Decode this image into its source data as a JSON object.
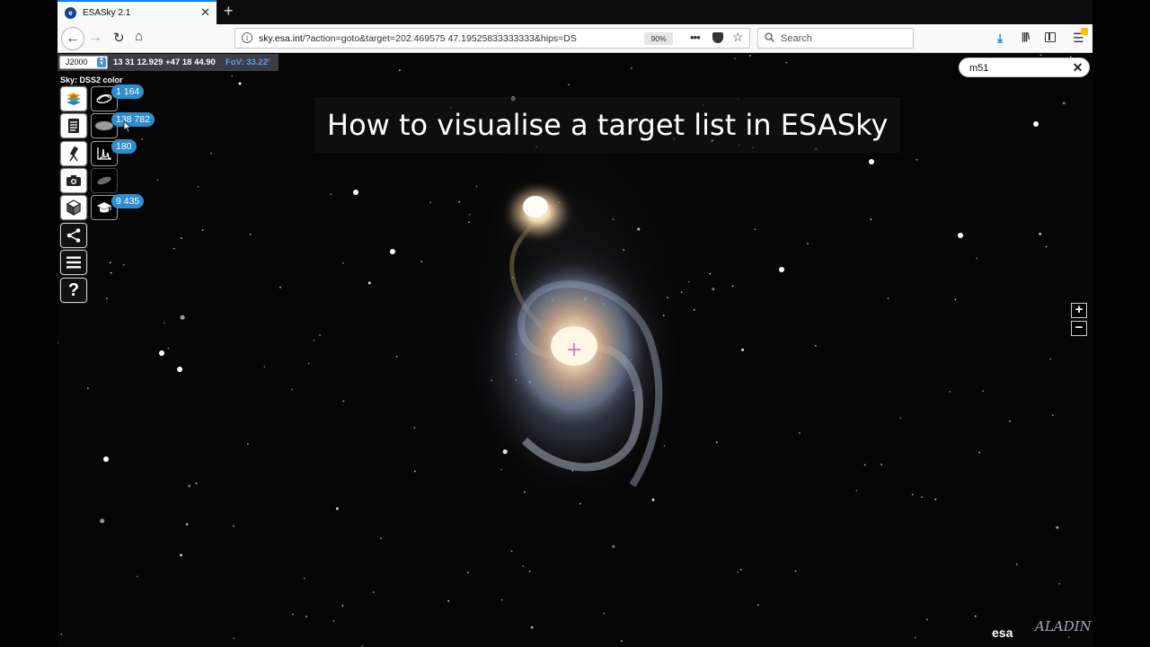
{
  "browser": {
    "tab_title": "ESASky 2.1",
    "favicon_letter": "e",
    "url_host": "sky.esa.int",
    "url_rest": "/?action=goto&target=202.469575 47.19525833333333&hips=DS",
    "zoom_level": "90%",
    "search_placeholder": "Search"
  },
  "esasky": {
    "frame": "J2000",
    "coordinates": "13 31 12.929 +47 18 44.90",
    "fov": "FoV: 33.22'",
    "sky_label": "Sky: DSS2 color",
    "target_query": "m51",
    "overlay_title": "How to visualise a target list in ESASky",
    "badges": {
      "galaxies": "1 164",
      "catalogues": "138 782",
      "spectra": "180",
      "publications": "9 435"
    },
    "icons": [
      "sky-layers-icon",
      "galaxy-icon",
      "catalogue-list-icon",
      "catalogue-disk-icon",
      "telescope-icon",
      "spectra-icon",
      "camera-icon",
      "tilted-ellipse-icon",
      "cube-icon",
      "graduation-cap-icon",
      "share-icon",
      "menu-icon",
      "help-icon"
    ],
    "zoom_in": "+",
    "zoom_out": "−",
    "logo_esa": "esa",
    "logo_aladin": "ALADIN"
  },
  "colors": {
    "badge": "#2d8dcf",
    "fov_text": "#5f9bf0",
    "coord_bar": "#3d3d45",
    "sky_background": "#050505"
  }
}
